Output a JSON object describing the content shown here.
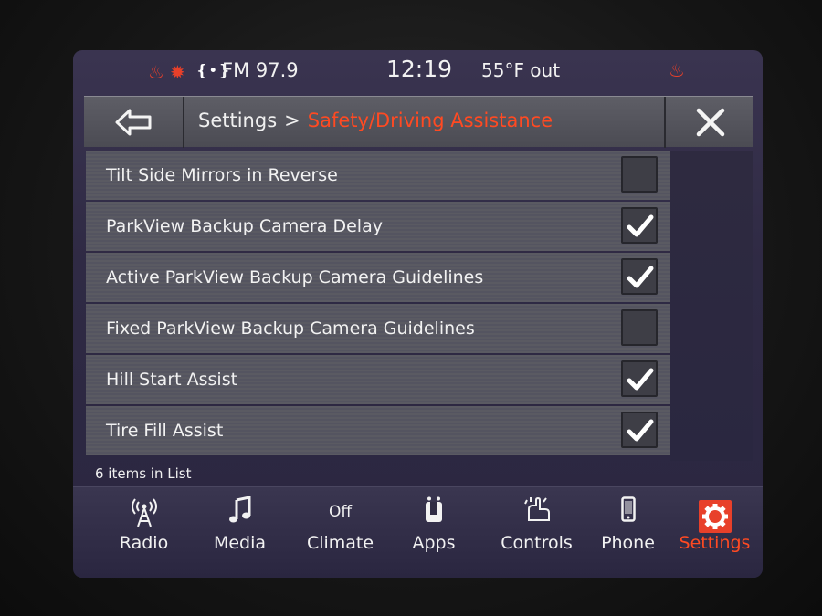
{
  "status_bar": {
    "station": "FM 97.9",
    "clock": "12:19",
    "temperature": "55°F out"
  },
  "header": {
    "breadcrumb_root": "Settings",
    "breadcrumb_separator": ">",
    "breadcrumb_current": "Safety/Driving Assistance"
  },
  "settings_list": [
    {
      "label": "Tilt Side Mirrors in Reverse",
      "checked": false
    },
    {
      "label": "ParkView Backup Camera Delay",
      "checked": true
    },
    {
      "label": "Active ParkView Backup Camera Guidelines",
      "checked": true
    },
    {
      "label": "Fixed ParkView Backup Camera Guidelines",
      "checked": false
    },
    {
      "label": "Hill Start Assist",
      "checked": true
    },
    {
      "label": "Tire Fill Assist",
      "checked": true
    }
  ],
  "list_count": "6 items in List",
  "nav": {
    "radio": "Radio",
    "media": "Media",
    "climate_status": "Off",
    "climate": "Climate",
    "apps": "Apps",
    "controls": "Controls",
    "phone": "Phone",
    "settings": "Settings"
  },
  "colors": {
    "accent": "#ff4a22",
    "heat_indicator": "#e8402a",
    "background": "#2f2a44"
  }
}
